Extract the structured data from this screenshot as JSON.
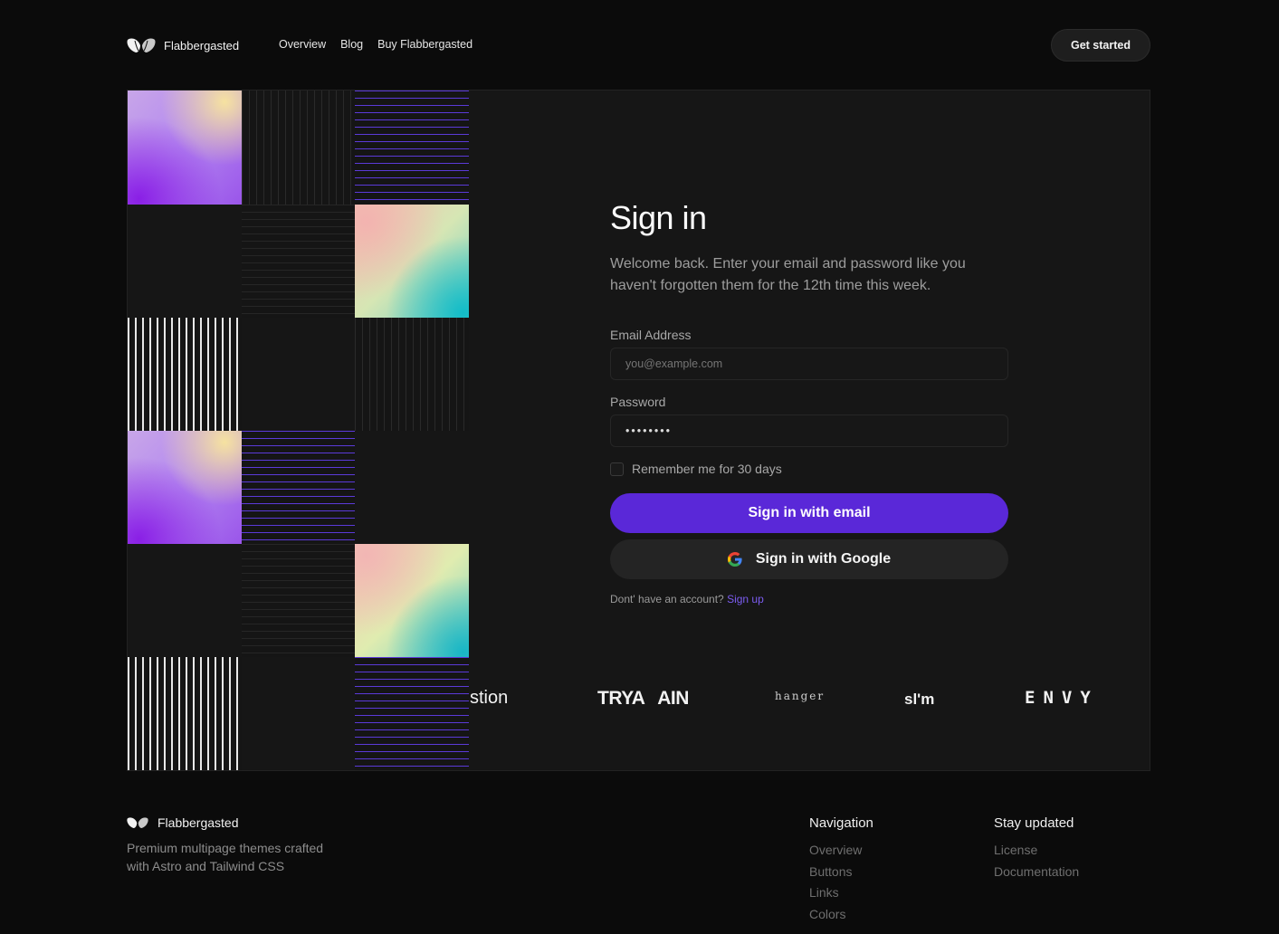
{
  "header": {
    "brand_name": "Flabbergasted",
    "nav": [
      "Overview",
      "Blog",
      "Buy Flabbergasted"
    ],
    "cta_label": "Get started"
  },
  "signin": {
    "title": "Sign in",
    "subtitle": "Welcome back. Enter your email and password like you haven't forgotten them for the 12th time this week.",
    "email_label": "Email Address",
    "email_placeholder": "you@example.com",
    "password_label": "Password",
    "password_value": "••••••••",
    "remember_label": "Remember me for 30 days",
    "remember_checked": false,
    "email_button": "Sign in with email",
    "google_button": "Sign in with Google",
    "signup_prompt": "Dont' have an account?",
    "signup_link": "Sign up"
  },
  "logos": [
    "stion",
    "TRYA  AIN",
    "hanger",
    "sl'm",
    "ENVY"
  ],
  "footer": {
    "brand_name": "Flabbergasted",
    "tagline": "Premium multipage themes crafted with Astro and Tailwind CSS",
    "nav_heading": "Navigation",
    "nav_links": [
      "Overview",
      "Buttons",
      "Links",
      "Colors"
    ],
    "updates_heading": "Stay updated",
    "updates_links": [
      "License",
      "Documentation"
    ]
  },
  "colors": {
    "background": "#0b0b0b",
    "card": "#161616",
    "accent_purple": "#5a28d8",
    "link_purple": "#7b5cf0"
  }
}
